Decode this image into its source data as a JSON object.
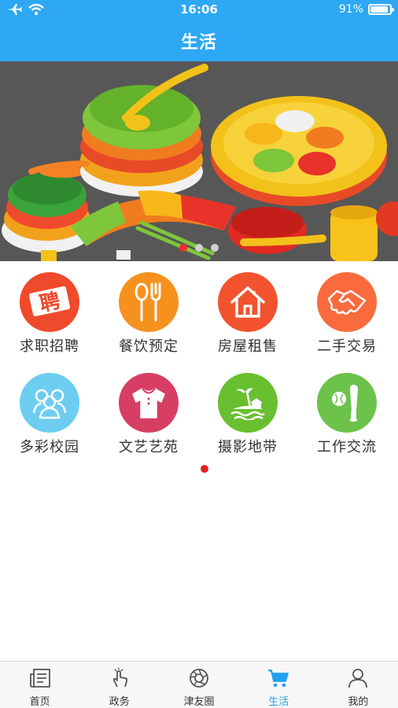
{
  "status_bar": {
    "time": "16:06",
    "battery_text": "91%",
    "battery_level": 0.91
  },
  "header": {
    "title": "生活"
  },
  "banner": {
    "slides": 3,
    "active_index": 0
  },
  "grid": {
    "items": [
      {
        "label": "求职招聘",
        "icon": "hire-icon",
        "color": "#ef4a2b"
      },
      {
        "label": "餐饮预定",
        "icon": "spoon-fork-icon",
        "color": "#f6911e"
      },
      {
        "label": "房屋租售",
        "icon": "house-icon",
        "color": "#f2532e"
      },
      {
        "label": "二手交易",
        "icon": "handshake-icon",
        "color": "#f96b3c"
      },
      {
        "label": "多彩校园",
        "icon": "people-icon",
        "color": "#6dcdf0"
      },
      {
        "label": "文艺艺苑",
        "icon": "shirt-icon",
        "color": "#d63e63"
      },
      {
        "label": "摄影地带",
        "icon": "island-icon",
        "color": "#68bf2f"
      },
      {
        "label": "工作交流",
        "icon": "baseball-icon",
        "color": "#6cc24a"
      }
    ],
    "pages": 1,
    "active_page": 0
  },
  "tabbar": {
    "items": [
      {
        "label": "首页",
        "icon": "newspaper-icon",
        "active": false
      },
      {
        "label": "政务",
        "icon": "tap-hand-icon",
        "active": false
      },
      {
        "label": "津友圈",
        "icon": "camera-shutter-icon",
        "active": false
      },
      {
        "label": "生活",
        "icon": "shopping-cart-icon",
        "active": true
      },
      {
        "label": "我的",
        "icon": "person-icon",
        "active": false
      }
    ]
  },
  "colors": {
    "primary": "#2ea8f4",
    "active_tab": "#23a0ef",
    "dot_active": "#e22020"
  }
}
